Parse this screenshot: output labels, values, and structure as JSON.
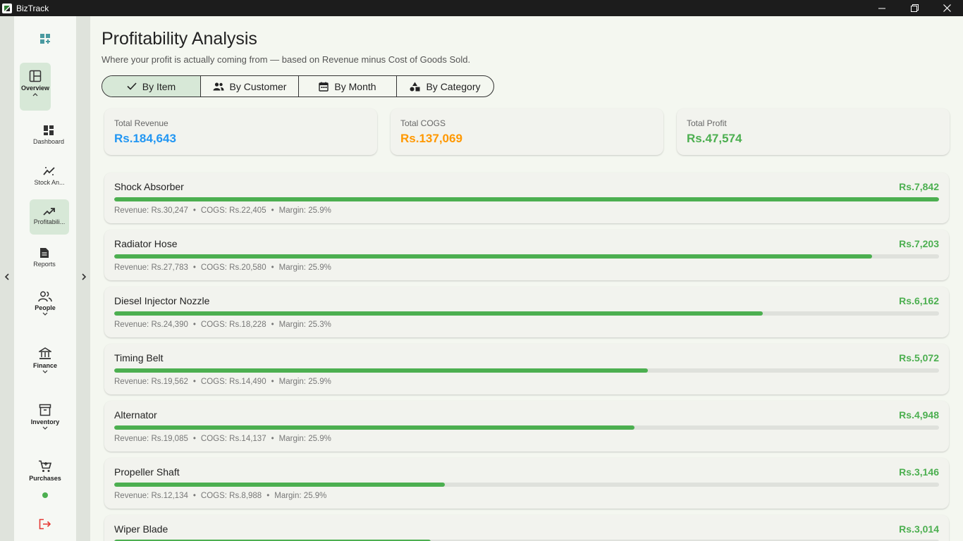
{
  "window": {
    "title": "BizTrack"
  },
  "sidebar": {
    "items": [
      {
        "id": "overview",
        "label": "Overview",
        "icon": "panel-icon"
      },
      {
        "id": "dashboard",
        "label": "Dashboard",
        "icon": "dashboard-icon"
      },
      {
        "id": "stock",
        "label": "Stock An...",
        "icon": "stock-analysis-icon"
      },
      {
        "id": "profit",
        "label": "Profitabili...",
        "icon": "trending-up-icon"
      },
      {
        "id": "reports",
        "label": "Reports",
        "icon": "document-icon"
      },
      {
        "id": "people",
        "label": "People",
        "icon": "people-icon"
      },
      {
        "id": "finance",
        "label": "Finance",
        "icon": "bank-icon"
      },
      {
        "id": "inventory",
        "label": "Inventory",
        "icon": "archive-box-icon"
      },
      {
        "id": "purchases",
        "label": "Purchases",
        "icon": "cart-icon"
      }
    ]
  },
  "page": {
    "title": "Profitability Analysis",
    "subtitle": "Where your profit is actually coming from — based on Revenue minus Cost of Goods Sold."
  },
  "segments": [
    {
      "label": "By Item",
      "active": true
    },
    {
      "label": "By Customer",
      "active": false
    },
    {
      "label": "By Month",
      "active": false
    },
    {
      "label": "By Category",
      "active": false
    }
  ],
  "stats": [
    {
      "label": "Total Revenue",
      "value": "Rs.184,643",
      "color": "#2196f3"
    },
    {
      "label": "Total COGS",
      "value": "Rs.137,069",
      "color": "#ff9800"
    },
    {
      "label": "Total Profit",
      "value": "Rs.47,574",
      "color": "#4caf50"
    }
  ],
  "meta_labels": {
    "revenue": "Revenue:",
    "cogs": "COGS:",
    "margin": "Margin:"
  },
  "items": [
    {
      "name": "Shock Absorber",
      "profit": "Rs.7,842",
      "revenue": "Rs.30,247",
      "cogs": "Rs.22,405",
      "margin": "25.9%",
      "bar_fraction": 1.0
    },
    {
      "name": "Radiator Hose",
      "profit": "Rs.7,203",
      "revenue": "Rs.27,783",
      "cogs": "Rs.20,580",
      "margin": "25.9%",
      "bar_fraction": 0.919
    },
    {
      "name": "Diesel Injector Nozzle",
      "profit": "Rs.6,162",
      "revenue": "Rs.24,390",
      "cogs": "Rs.18,228",
      "margin": "25.3%",
      "bar_fraction": 0.786
    },
    {
      "name": "Timing Belt",
      "profit": "Rs.5,072",
      "revenue": "Rs.19,562",
      "cogs": "Rs.14,490",
      "margin": "25.9%",
      "bar_fraction": 0.647
    },
    {
      "name": "Alternator",
      "profit": "Rs.4,948",
      "revenue": "Rs.19,085",
      "cogs": "Rs.14,137",
      "margin": "25.9%",
      "bar_fraction": 0.631
    },
    {
      "name": "Propeller Shaft",
      "profit": "Rs.3,146",
      "revenue": "Rs.12,134",
      "cogs": "Rs.8,988",
      "margin": "25.9%",
      "bar_fraction": 0.401
    },
    {
      "name": "Wiper Blade",
      "profit": "Rs.3,014",
      "revenue": "",
      "cogs": "",
      "margin": "",
      "bar_fraction": 0.384
    }
  ],
  "colors": {
    "accent": "#4caf50",
    "active_nav": "#d7e8d7",
    "logout": "#e53935"
  }
}
